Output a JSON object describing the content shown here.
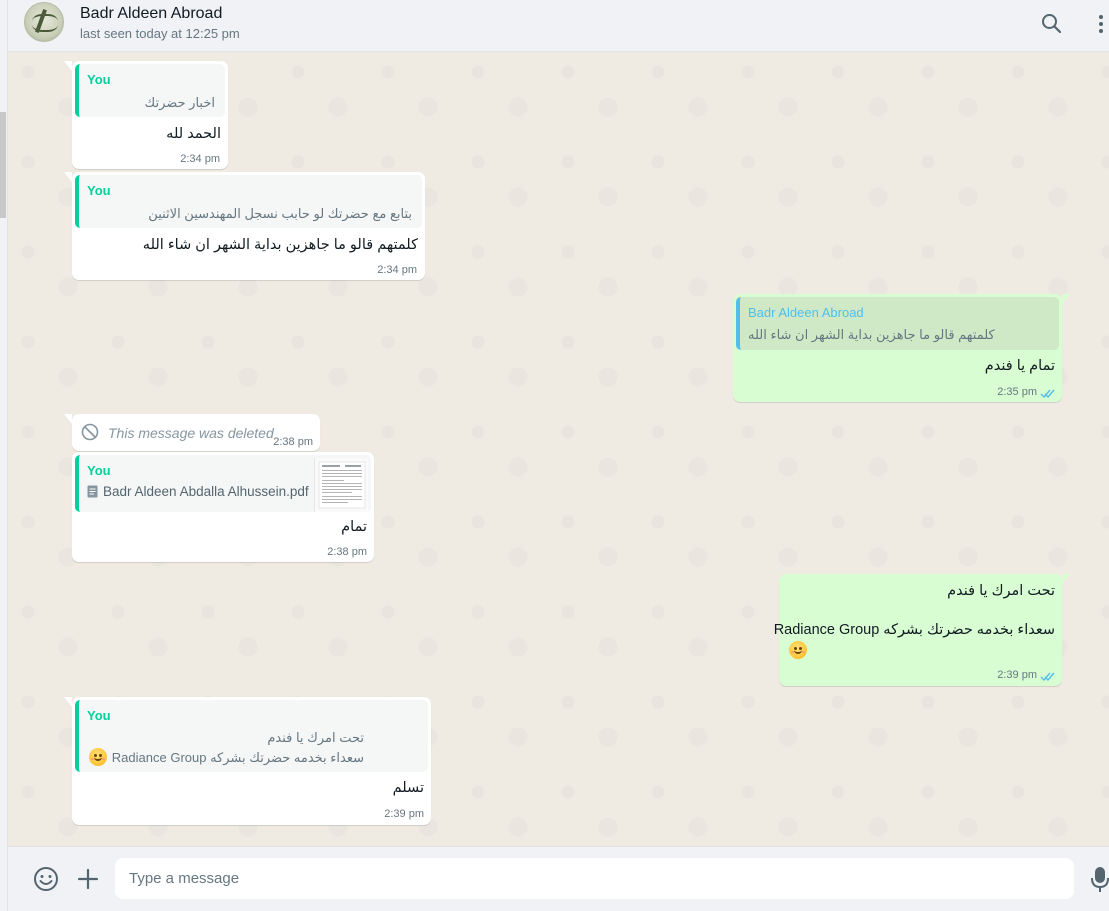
{
  "header": {
    "contact_name": "Badr Aldeen Abroad",
    "status": "last seen today at 12:25 pm",
    "icons": [
      "search-icon",
      "menu-icon"
    ]
  },
  "messages": [
    {
      "direction": "in",
      "quote_author": "You",
      "quote_text": "اخبار حضرتك",
      "text": "الحمد لله",
      "time": "2:34 pm"
    },
    {
      "direction": "in",
      "quote_author": "You",
      "quote_text": "بتابع مع حضرتك لو حابب نسجل المهندسين الاثنين",
      "text": "كلمتهم قالو ما جاهزين بداية الشهر ان شاء الله",
      "time": "2:34 pm"
    },
    {
      "direction": "out",
      "quote_author": "Badr Aldeen Abroad",
      "quote_text": "كلمتهم قالو ما جاهزين بداية الشهر ان شاء الله",
      "text": "تمام يا فندم",
      "time": "2:35 pm",
      "status": "read"
    },
    {
      "direction": "in",
      "deleted": true,
      "text": "This message was deleted",
      "time": "2:38 pm"
    },
    {
      "direction": "in",
      "quote_author": "You",
      "quote_file": "Badr Aldeen Abdalla Alhussein.pdf",
      "text": "تمام",
      "time": "2:38 pm"
    },
    {
      "direction": "out",
      "line1": "تحت امرك يا فندم",
      "line2": "سعداء بخدمه حضرتك بشركه Radiance Group",
      "emoji": "smiling-face-emoji",
      "time": "2:39 pm",
      "status": "read"
    },
    {
      "direction": "in",
      "quote_author": "You",
      "quote_line1": "تحت امرك يا فندم",
      "quote_line2": "سعداء بخدمه حضرتك بشركه Radiance Group",
      "quote_emoji": "smiling-face-emoji",
      "text": "تسلم",
      "time": "2:39 pm"
    }
  ],
  "composer": {
    "placeholder": "Type a message",
    "icons": [
      "emoji-icon",
      "attach-icon",
      "mic-icon"
    ]
  },
  "colors": {
    "header_bg": "#f0f2f5",
    "chat_bg": "#efeae2",
    "incoming_bubble": "#ffffff",
    "outgoing_bubble": "#d9fdd3",
    "quote_accent": "#06cf9c",
    "read_ticks": "#53bdeb"
  }
}
